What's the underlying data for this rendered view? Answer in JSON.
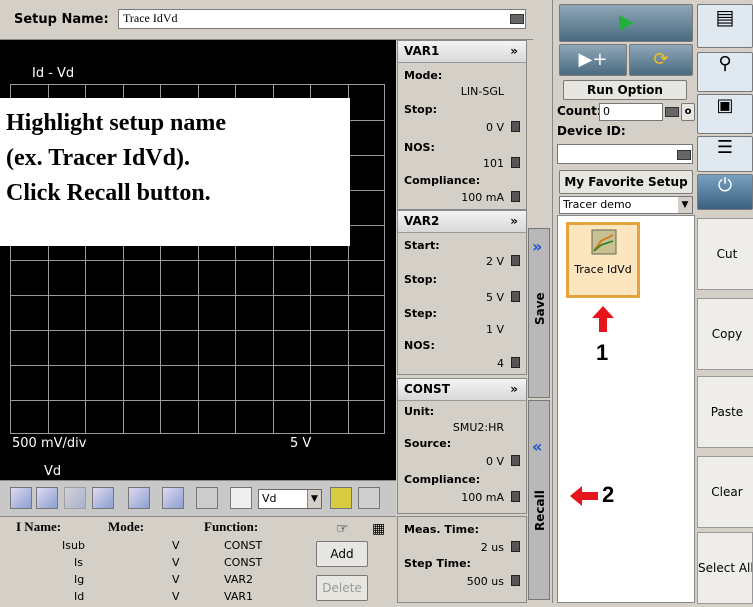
{
  "setup": {
    "label": "Setup Name:",
    "value": "Trace IdVd"
  },
  "graph": {
    "title": "Id - Vd",
    "scale": "500 mV/div",
    "xmax": "5 V",
    "xlabel": "Vd"
  },
  "instructions": [
    "Highlight setup name",
    "(ex. Tracer IdVd).",
    "Click Recall button."
  ],
  "toolbar": {
    "var_select": "Vd"
  },
  "smu_table": {
    "headers": {
      "name": "I Name:",
      "mode": "Mode:",
      "function": "Function:"
    },
    "rows": [
      {
        "name": "Isub",
        "mode": "V",
        "function": "CONST"
      },
      {
        "name": "Is",
        "mode": "V",
        "function": "CONST"
      },
      {
        "name": "Ig",
        "mode": "V",
        "function": "VAR2"
      },
      {
        "name": "Id",
        "mode": "V",
        "function": "VAR1"
      }
    ],
    "add": "Add",
    "delete": "Delete"
  },
  "var1": {
    "title": "VAR1",
    "mode_label": "Mode:",
    "mode": "LIN-SGL",
    "stop_label": "Stop:",
    "stop": "0 V",
    "nos_label": "NOS:",
    "nos": "101",
    "compliance_label": "Compliance:",
    "compliance": "100 mA"
  },
  "var2": {
    "title": "VAR2",
    "start_label": "Start:",
    "start": "2 V",
    "stop_label": "Stop:",
    "stop": "5 V",
    "step_label": "Step:",
    "step": "1 V",
    "nos_label": "NOS:",
    "nos": "4"
  },
  "const": {
    "title": "CONST",
    "unit_label": "Unit:",
    "unit": "SMU2:HR",
    "source_label": "Source:",
    "source": "0 V",
    "compliance_label": "Compliance:",
    "compliance": "100 mA"
  },
  "timing": {
    "meas_label": "Meas. Time:",
    "meas": "2 us",
    "step_label": "Step Time:",
    "step": "500 us"
  },
  "tabs": {
    "save": "Save",
    "recall": "Recall"
  },
  "run": {
    "option": "Run Option",
    "count_label": "Count:",
    "count": "0",
    "device_label": "Device ID:"
  },
  "favorites": {
    "button": "My Favorite Setup",
    "category": "Tracer demo",
    "item": "Trace IdVd"
  },
  "annotations": {
    "step1": "1",
    "step2": "2"
  },
  "edit": {
    "cut": "Cut",
    "copy": "Copy",
    "paste": "Paste",
    "clear": "Clear",
    "select_all": "Select All"
  },
  "colors": {
    "accent_red": "#e8141c",
    "highlight_orange": "#e8a23c",
    "play_green": "#22b03a"
  }
}
